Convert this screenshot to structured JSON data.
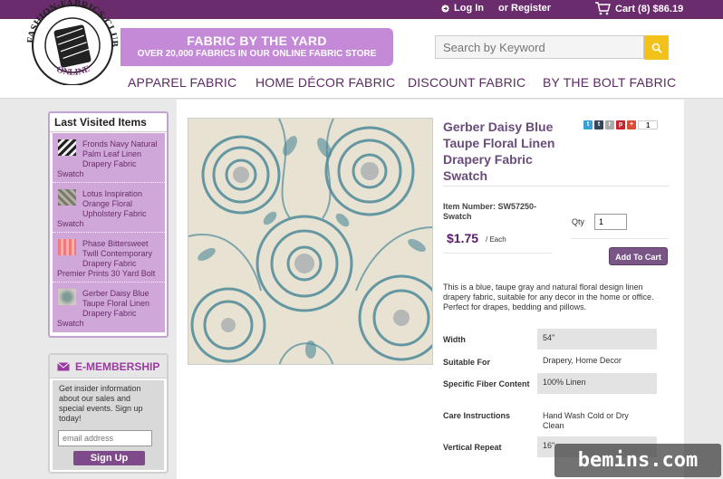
{
  "topbar": {
    "login": "Log In",
    "register": "or Register",
    "cart": "Cart (8) $86.19"
  },
  "logo": {
    "text_top": "FASHION·FABRICS·CLUB",
    "text_bottom": "ONLINE"
  },
  "banner": {
    "line1": "FABRIC BY THE YARD",
    "line2": "OVER 20,000 FABRICS IN OUR ONLINE FABRIC STORE"
  },
  "search": {
    "placeholder": "Search by Keyword"
  },
  "nav": {
    "items": [
      "APPAREL FABRIC",
      "HOME DÉCOR FABRIC",
      "DISCOUNT FABRIC",
      "BY THE BOLT FABRIC"
    ]
  },
  "sidebar": {
    "title": "Last Visited Items",
    "items": [
      {
        "label": "Fronds Navy Natural Palm Leaf Linen Drapery Fabric",
        "tail": "Swatch",
        "thumb_color": "#3a3a3a"
      },
      {
        "label": "Lotus Inspiration Orange Floral Upholstery Fabric",
        "tail": "Swatch",
        "thumb_color": "#8a8a80"
      },
      {
        "label": "Phase Bittersweet Twill Contemporary Drapery Fabric",
        "tail": "Premier Prints 30 Yard Bolt",
        "thumb_color": "#f08a8a"
      },
      {
        "label": "Gerber Daisy Blue Taupe Floral Linen Drapery Fabric",
        "tail": "Swatch",
        "thumb_color": "#9aa8a4"
      }
    ]
  },
  "membership": {
    "title": "E-MEMBERSHIP",
    "text": "Get insider information about our sales and special events. Sign up today!",
    "email_placeholder": "email address",
    "button": "Sign Up"
  },
  "product": {
    "title": "Gerber Daisy Blue Taupe Floral Linen Drapery Fabric Swatch",
    "share_count": "1",
    "item_number": "Item Number: SW57250-Swatch",
    "price": "$1.75",
    "unit": "/ Each",
    "qty_label": "Qty",
    "qty_value": "1",
    "add_to_cart": "Add To Cart",
    "description": "This is a blue, taupe gray and natural floral design linen drapery fabric, suitable for any decor in the home or office. Perfect for drapes, bedding and pillows.",
    "specs": [
      {
        "label": "Width",
        "value": "54\""
      },
      {
        "label": "Suitable For",
        "value": "Drapery, Home Decor"
      },
      {
        "label": "Specific Fiber Content",
        "value": "100% Linen"
      },
      {
        "label": "Care Instructions",
        "value": "Hand Wash Cold or Dry Clean"
      },
      {
        "label": "Vertical Repeat",
        "value": "16\""
      }
    ]
  },
  "watermark": "bemins.com",
  "colors": {
    "brand_purple": "#6a2c6c",
    "banner": "#c48ad7",
    "search_button": "#f2c21b",
    "fabric_blue": "#4f8a9a"
  }
}
